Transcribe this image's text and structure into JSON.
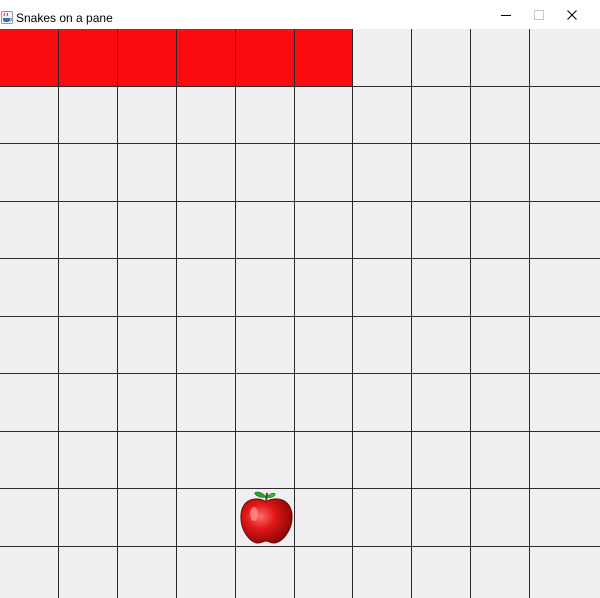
{
  "window": {
    "title": "Snakes on a pane",
    "app_icon": "java-cup-icon",
    "controls": {
      "minimize": "minimize-icon",
      "maximize": "maximize-icon",
      "close": "close-icon"
    }
  },
  "board": {
    "columns": 10,
    "rows": 10,
    "cell_color": "#efeef1",
    "grid_line_color": "#2a2a2a",
    "snake_color": "#fb0b0e",
    "snake_cells": [
      [
        0,
        0
      ],
      [
        1,
        0
      ],
      [
        2,
        0
      ],
      [
        3,
        0
      ],
      [
        4,
        0
      ],
      [
        5,
        0
      ]
    ],
    "apple_cell": [
      4,
      8
    ],
    "apple_icon": "apple-icon"
  }
}
